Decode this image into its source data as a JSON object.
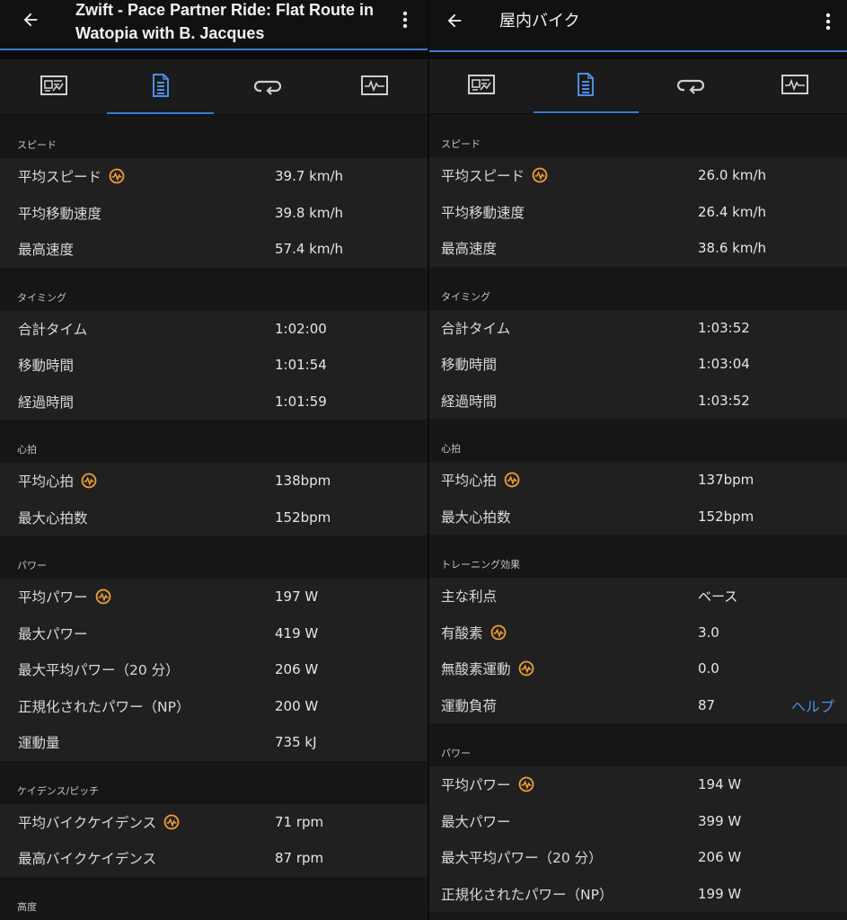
{
  "left": {
    "title": "Zwift - Pace Partner Ride: Flat Route in Watopia with B. Jacques",
    "active_tab": 1,
    "sections": [
      {
        "label": "スピード",
        "rows": [
          {
            "label": "平均スピード",
            "badge": true,
            "value": "39.7 km/h"
          },
          {
            "label": "平均移動速度",
            "value": "39.8 km/h"
          },
          {
            "label": "最高速度",
            "value": "57.4 km/h"
          }
        ]
      },
      {
        "label": "タイミング",
        "rows": [
          {
            "label": "合計タイム",
            "value": "1:02:00"
          },
          {
            "label": "移動時間",
            "value": "1:01:54"
          },
          {
            "label": "経過時間",
            "value": "1:01:59"
          }
        ]
      },
      {
        "label": "心拍",
        "rows": [
          {
            "label": "平均心拍",
            "badge": true,
            "value": "138bpm"
          },
          {
            "label": "最大心拍数",
            "value": "152bpm"
          }
        ]
      },
      {
        "label": "パワー",
        "rows": [
          {
            "label": "平均パワー",
            "badge": true,
            "value": "197 W"
          },
          {
            "label": "最大パワー",
            "value": "419 W"
          },
          {
            "label": "最大平均パワー（20 分）",
            "value": "206 W"
          },
          {
            "label": "正規化されたパワー（NP）",
            "value": "200 W"
          },
          {
            "label": "運動量",
            "value": "735 kJ"
          }
        ]
      },
      {
        "label": "ケイデンス/ピッチ",
        "rows": [
          {
            "label": "平均バイクケイデンス",
            "badge": true,
            "value": "71 rpm"
          },
          {
            "label": "最高バイクケイデンス",
            "value": "87 rpm"
          }
        ]
      },
      {
        "label": "高度",
        "rows": []
      }
    ]
  },
  "right": {
    "title": "屋内バイク",
    "active_tab": 1,
    "sections": [
      {
        "label": "スピード",
        "rows": [
          {
            "label": "平均スピード",
            "badge": true,
            "value": "26.0 km/h"
          },
          {
            "label": "平均移動速度",
            "value": "26.4 km/h"
          },
          {
            "label": "最高速度",
            "value": "38.6 km/h"
          }
        ]
      },
      {
        "label": "タイミング",
        "rows": [
          {
            "label": "合計タイム",
            "value": "1:03:52"
          },
          {
            "label": "移動時間",
            "value": "1:03:04"
          },
          {
            "label": "経過時間",
            "value": "1:03:52"
          }
        ]
      },
      {
        "label": "心拍",
        "rows": [
          {
            "label": "平均心拍",
            "badge": true,
            "value": "137bpm"
          },
          {
            "label": "最大心拍数",
            "value": "152bpm"
          }
        ]
      },
      {
        "label": "トレーニング効果",
        "rows": [
          {
            "label": "主な利点",
            "value": "ベース"
          },
          {
            "label": "有酸素",
            "badge": true,
            "value": "3.0"
          },
          {
            "label": "無酸素運動",
            "badge": true,
            "value": "0.0"
          },
          {
            "label": "運動負荷",
            "value": "87",
            "link": "ヘルプ"
          }
        ]
      },
      {
        "label": "パワー",
        "rows": [
          {
            "label": "平均パワー",
            "badge": true,
            "value": "194 W"
          },
          {
            "label": "最大パワー",
            "value": "399 W"
          },
          {
            "label": "最大平均パワー（20 分）",
            "value": "206 W"
          },
          {
            "label": "正規化されたパワー（NP）",
            "value": "199 W"
          }
        ]
      }
    ]
  },
  "tabs": [
    "overview-icon",
    "details-icon",
    "laps-icon",
    "charts-icon"
  ],
  "colors": {
    "accent": "#3a7bd0",
    "badge": "#f0a030",
    "link": "#4d90e2"
  }
}
